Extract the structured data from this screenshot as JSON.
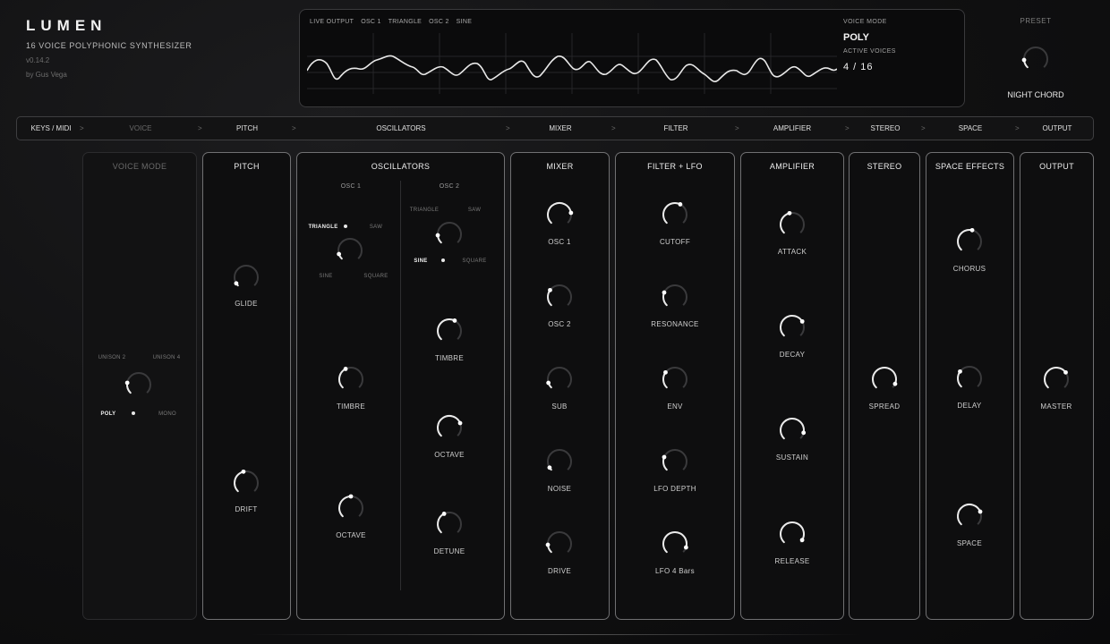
{
  "brand": {
    "title": "LUMEN",
    "subtitle": "16 VOICE POLYPHONIC SYNTHESIZER",
    "version": "v0.14.2",
    "author": "by Gus Vega"
  },
  "display": {
    "labels": [
      "LIVE OUTPUT",
      "OSC 1",
      "TRIANGLE",
      "OSC 2",
      "SINE"
    ],
    "voice_mode_label": "VOICE MODE",
    "voice_mode_value": "POLY",
    "active_voices_label": "ACTIVE VOICES",
    "active_voices_value": "4 / 16"
  },
  "preset": {
    "label": "PRESET",
    "name": "NIGHT CHORD",
    "knob_value": 0.15
  },
  "nav": {
    "items": [
      {
        "label": "KEYS / MIDI",
        "active": true
      },
      {
        "label": "VOICE",
        "active": false
      },
      {
        "label": "PITCH",
        "active": true
      },
      {
        "label": "OSCILLATORS",
        "active": true
      },
      {
        "label": "MIXER",
        "active": true
      },
      {
        "label": "FILTER",
        "active": true
      },
      {
        "label": "AMPLIFIER",
        "active": true
      },
      {
        "label": "STEREO",
        "active": true
      },
      {
        "label": "SPACE",
        "active": true
      },
      {
        "label": "OUTPUT",
        "active": true
      }
    ],
    "separator": ">"
  },
  "panels": {
    "voice_mode": {
      "title": "VOICE MODE",
      "options": {
        "unison2": "UNISON 2",
        "unison4": "UNISON 4",
        "poly": "POLY",
        "mono": "MONO"
      },
      "selected": "POLY"
    },
    "pitch": {
      "title": "PITCH",
      "knobs": [
        {
          "label": "GLIDE",
          "value": 0.05
        },
        {
          "label": "DRIFT",
          "value": 0.45
        }
      ]
    },
    "oscillators": {
      "title": "OSCILLATORS",
      "osc1": {
        "label": "OSC 1",
        "waves": {
          "triangle": "TRIANGLE",
          "saw": "SAW",
          "sine": "SINE",
          "square": "SQUARE"
        },
        "selected": "TRIANGLE",
        "knobs": [
          {
            "label": "TIMBRE",
            "value": 0.4
          },
          {
            "label": "OCTAVE",
            "value": 0.5
          }
        ]
      },
      "osc2": {
        "label": "OSC 2",
        "waves": {
          "triangle": "TRIANGLE",
          "saw": "SAW",
          "sine": "SINE",
          "square": "SQUARE"
        },
        "selected": "SINE",
        "knobs": [
          {
            "label": "TIMBRE",
            "value": 0.6
          },
          {
            "label": "OCTAVE",
            "value": 0.75
          },
          {
            "label": "DETUNE",
            "value": 0.4
          }
        ]
      }
    },
    "mixer": {
      "title": "MIXER",
      "knobs": [
        {
          "label": "OSC 1",
          "value": 0.8
        },
        {
          "label": "OSC 2",
          "value": 0.3
        },
        {
          "label": "SUB",
          "value": 0.1
        },
        {
          "label": "NOISE",
          "value": 0.05
        },
        {
          "label": "DRIVE",
          "value": 0.15
        }
      ]
    },
    "filter": {
      "title": "FILTER + LFO",
      "knobs": [
        {
          "label": "CUTOFF",
          "value": 0.6
        },
        {
          "label": "RESONANCE",
          "value": 0.25
        },
        {
          "label": "ENV",
          "value": 0.3
        },
        {
          "label": "LFO DEPTH",
          "value": 0.25
        },
        {
          "label": "LFO 4 Bars",
          "value": 0.9
        }
      ]
    },
    "amplifier": {
      "title": "AMPLIFIER",
      "knobs": [
        {
          "label": "ATTACK",
          "value": 0.45
        },
        {
          "label": "DECAY",
          "value": 0.72
        },
        {
          "label": "SUSTAIN",
          "value": 0.88
        },
        {
          "label": "RELEASE",
          "value": 0.95
        }
      ]
    },
    "stereo": {
      "title": "STEREO",
      "knobs": [
        {
          "label": "SPREAD",
          "value": 0.92
        }
      ]
    },
    "space": {
      "title": "SPACE EFFECTS",
      "knobs": [
        {
          "label": "CHORUS",
          "value": 0.55
        },
        {
          "label": "DELAY",
          "value": 0.3
        },
        {
          "label": "SPACE",
          "value": 0.75
        }
      ]
    },
    "output": {
      "title": "OUTPUT",
      "knobs": [
        {
          "label": "MASTER",
          "value": 0.7
        }
      ]
    }
  },
  "colors": {
    "accent": "#f2f2f2",
    "panel_border": "#707072",
    "background": "#101011"
  }
}
